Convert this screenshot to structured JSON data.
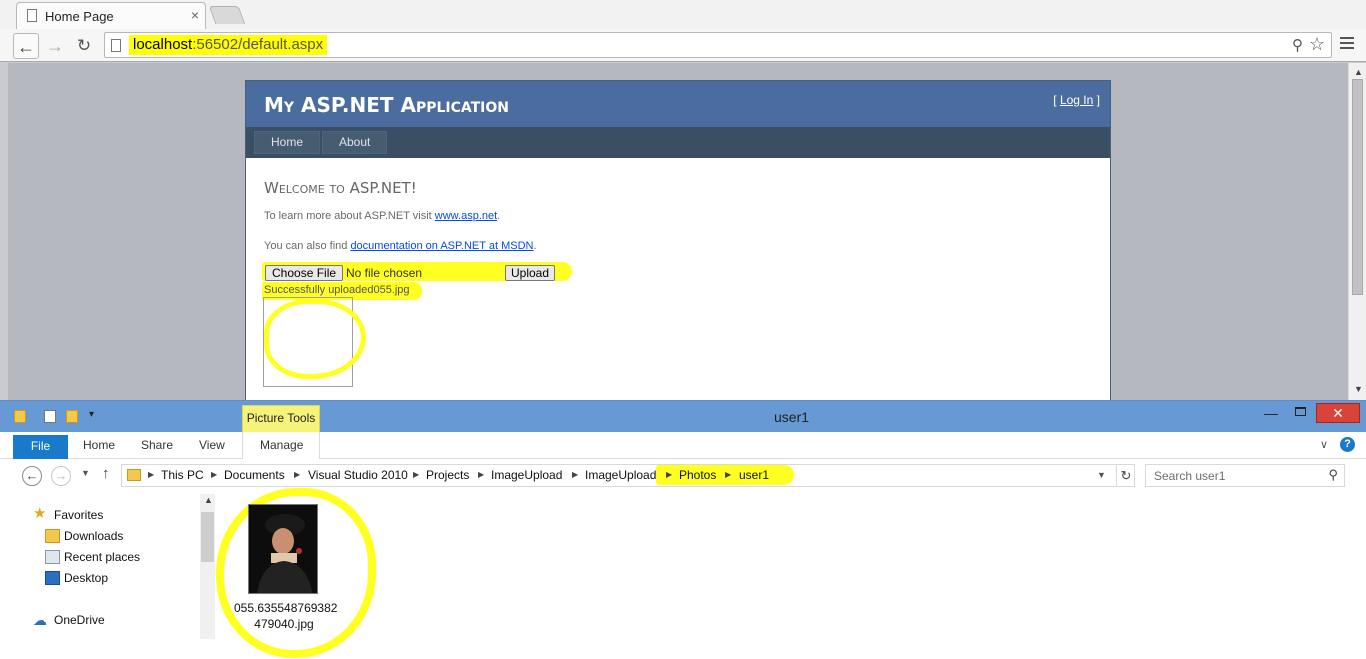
{
  "browser": {
    "tab_title": "Home Page",
    "tab_close": "×",
    "url_host": "localhost",
    "url_rest": ":56502/default.aspx",
    "nav": {
      "back": "←",
      "forward": "→",
      "reload": "↻"
    }
  },
  "site": {
    "title": "My ASP.NET Application",
    "login_open": "[ ",
    "login_link": "Log In",
    "login_close": " ]",
    "menu": [
      "Home",
      "About"
    ],
    "welcome": "Welcome to ASP.NET!",
    "para1_text": "To learn more about ASP.NET visit ",
    "para1_link": "www.asp.net",
    "para1_end": ".",
    "para2_text": "You can also find ",
    "para2_link": "documentation on ASP.NET at MSDN",
    "para2_end": ".",
    "choose_file_label": "Choose File",
    "no_file_text": "No file chosen",
    "upload_label": "Upload",
    "status_text": "Successfully uploaded055.jpg"
  },
  "explorer": {
    "window_title": "user1",
    "picture_tools": "Picture Tools",
    "ribbon_tabs": [
      "File",
      "Home",
      "Share",
      "View",
      "Manage"
    ],
    "breadcrumbs": [
      "This PC",
      "Documents",
      "Visual Studio 2010",
      "Projects",
      "ImageUpload",
      "ImageUpload",
      "Photos",
      "user1"
    ],
    "search_placeholder": "Search user1",
    "nav_items": [
      "Favorites",
      "Downloads",
      "Recent places",
      "Desktop",
      "OneDrive"
    ],
    "file_name_line1": "055.635548769382",
    "file_name_line2": "479040.jpg"
  },
  "colors": {
    "highlight": "#ffff22",
    "site_header": "#4b6c9e",
    "site_menu": "#3a4f63",
    "explorer_titlebar": "#6799d4",
    "file_tab": "#1979ca",
    "close_button": "#d9443a"
  }
}
